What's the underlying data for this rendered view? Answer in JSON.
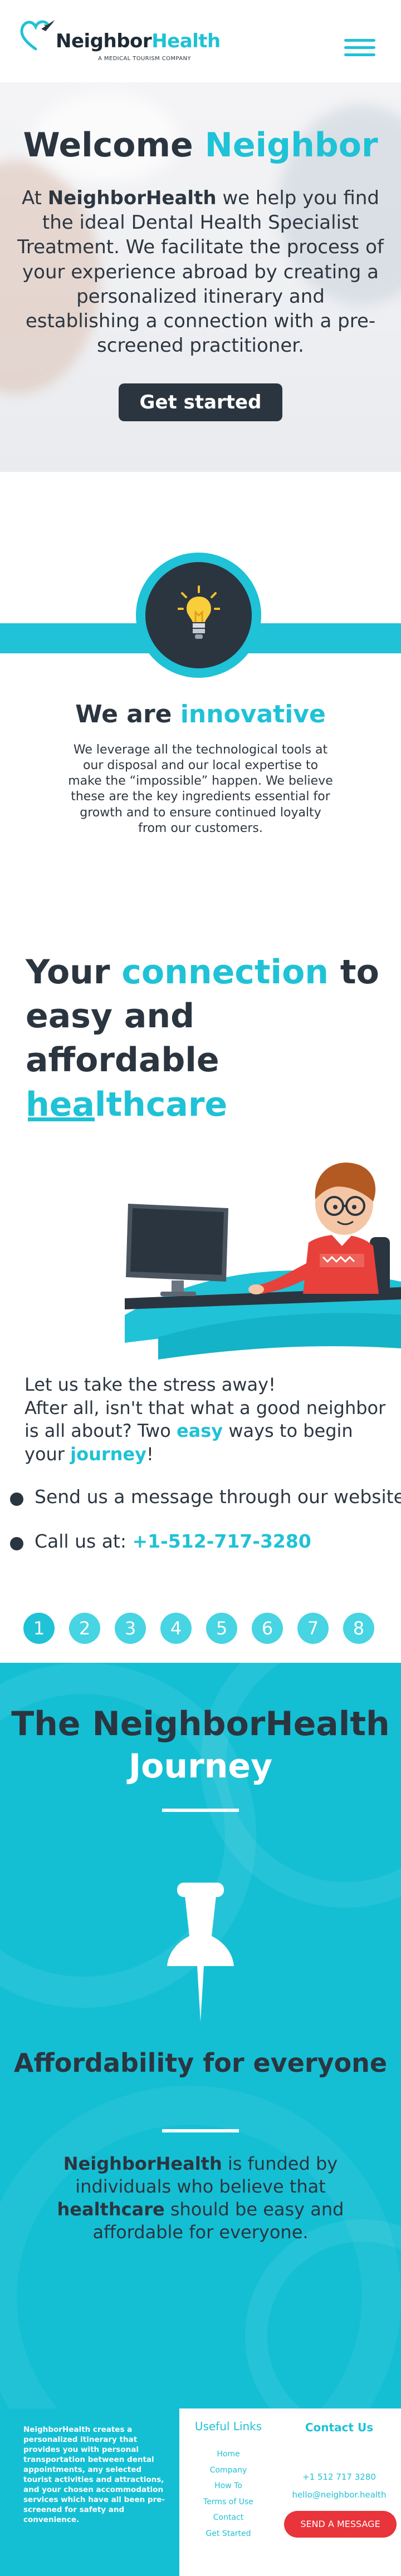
{
  "header": {
    "logo_name_a": "Neighbor",
    "logo_name_b": "Health",
    "logo_tagline": "A MEDICAL TOURISM COMPANY",
    "menu_icon": "hamburger-menu-icon"
  },
  "hero": {
    "title_a": "Welcome ",
    "title_b": "Neighbor",
    "body_a": "At ",
    "body_brand": "NeighborHealth",
    "body_b": " we help you find the ideal Dental Health Specialist Treatment. We facilitate the process of your experience abroad by creating a personalized itinerary and establishing a connection with a pre-screened practitioner.",
    "cta": "Get started"
  },
  "innovative": {
    "icon": "lightbulb-icon",
    "title_a": "We are ",
    "title_b": "innovative",
    "body": "We leverage all the technological tools at our disposal and our local expertise to make the “impossible” happen. We believe these are the key ingredients essential for growth and to ensure continued loyalty from our customers."
  },
  "connection": {
    "title_1": "Your ",
    "title_2": "connection",
    "title_3": " to easy and affordable ",
    "title_4": "healthcare",
    "illustration": "person-at-computer-illustration",
    "text_1": "Let us take the stress away!",
    "text_2": "After all, isn't that what a good neighbor is all about? Two ",
    "text_easy": "easy",
    "text_3": " ways to begin your ",
    "text_journey": "journey",
    "text_4": "!",
    "bullet_1": "Send us a message through our website",
    "bullet_2_a": "Call us at: ",
    "bullet_2_phone": "+1-512-717-3280",
    "steps": [
      "1",
      "2",
      "3",
      "4",
      "5",
      "6",
      "7",
      "8"
    ],
    "active_step": "1"
  },
  "journey": {
    "title_line1": "The NeighborHealth",
    "title_line2": "Journey",
    "icon": "push-pin-icon",
    "subtitle": "Affordability for everyone",
    "body_brand": "NeighborHealth",
    "body_a": " is funded by individuals who believe that ",
    "body_bold": "healthcare",
    "body_b": " should be easy and affordable for everyone."
  },
  "footer": {
    "about": "NeighborHealth creates a personalized itinerary that provides you with personal transportation between dental appointments, any selected tourist activities and attractions, and your chosen accommodation services which have all been pre-screened for safety and convenience.",
    "links_title": "Useful Links",
    "links": [
      "Home",
      "Company",
      "How To",
      "Terms of Use",
      "Contact",
      "Get Started"
    ],
    "contact_title": "Contact Us",
    "phone": "+1 512 717 3280",
    "email": "hello@neighbor.health",
    "send_button": "SEND A MESSAGE"
  },
  "colors": {
    "accent": "#1fc2d6",
    "dark": "#2b3540",
    "red_button": "#e8343a"
  }
}
